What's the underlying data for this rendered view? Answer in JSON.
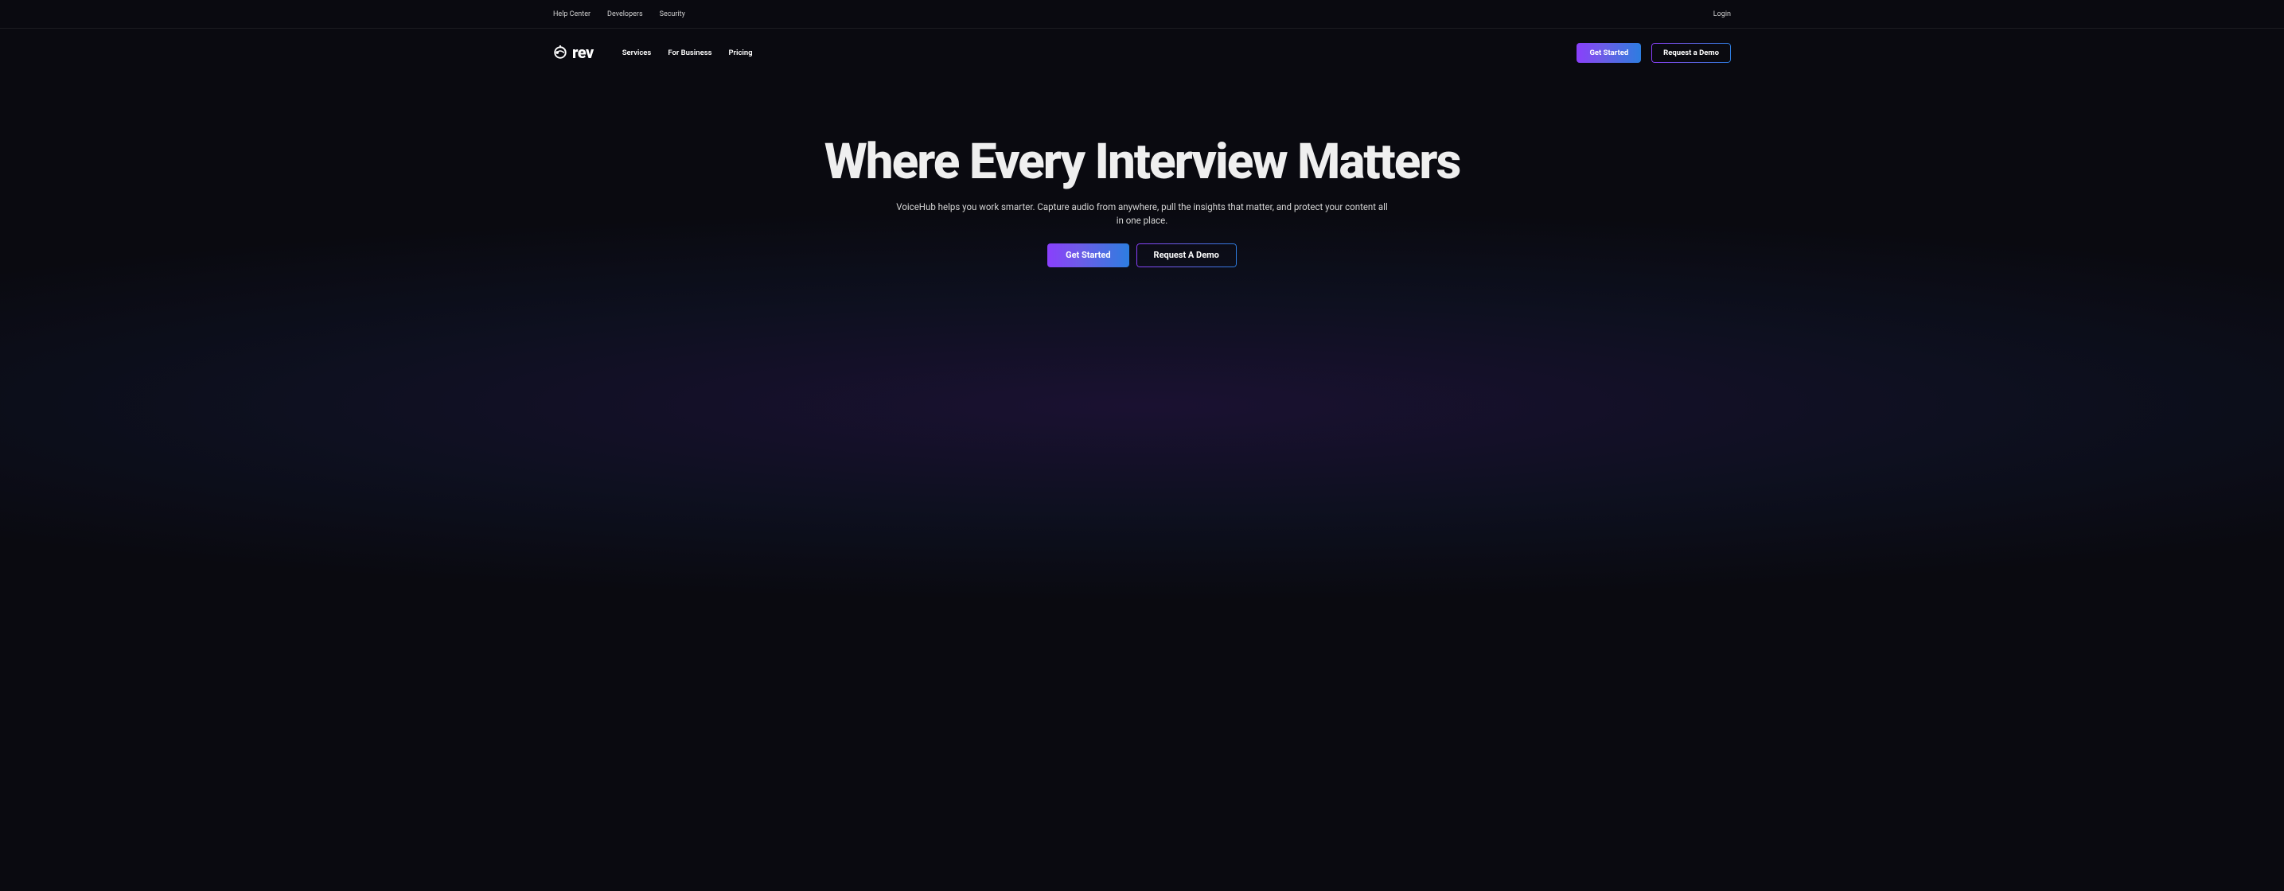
{
  "top_nav": {
    "left": [
      "Help Center",
      "Developers",
      "Security"
    ],
    "right": "Login"
  },
  "brand": {
    "name": "rev"
  },
  "main_nav": {
    "links": [
      "Services",
      "For Business",
      "Pricing"
    ],
    "cta_primary": "Get Started",
    "cta_secondary": "Request a Demo"
  },
  "hero": {
    "headline": "Where Every Interview Matters",
    "subheadline": "VoiceHub helps you work smarter. Capture audio from anywhere, pull the insights that matter, and protect your content all in one place.",
    "cta_primary": "Get Started",
    "cta_secondary": "Request A Demo"
  }
}
